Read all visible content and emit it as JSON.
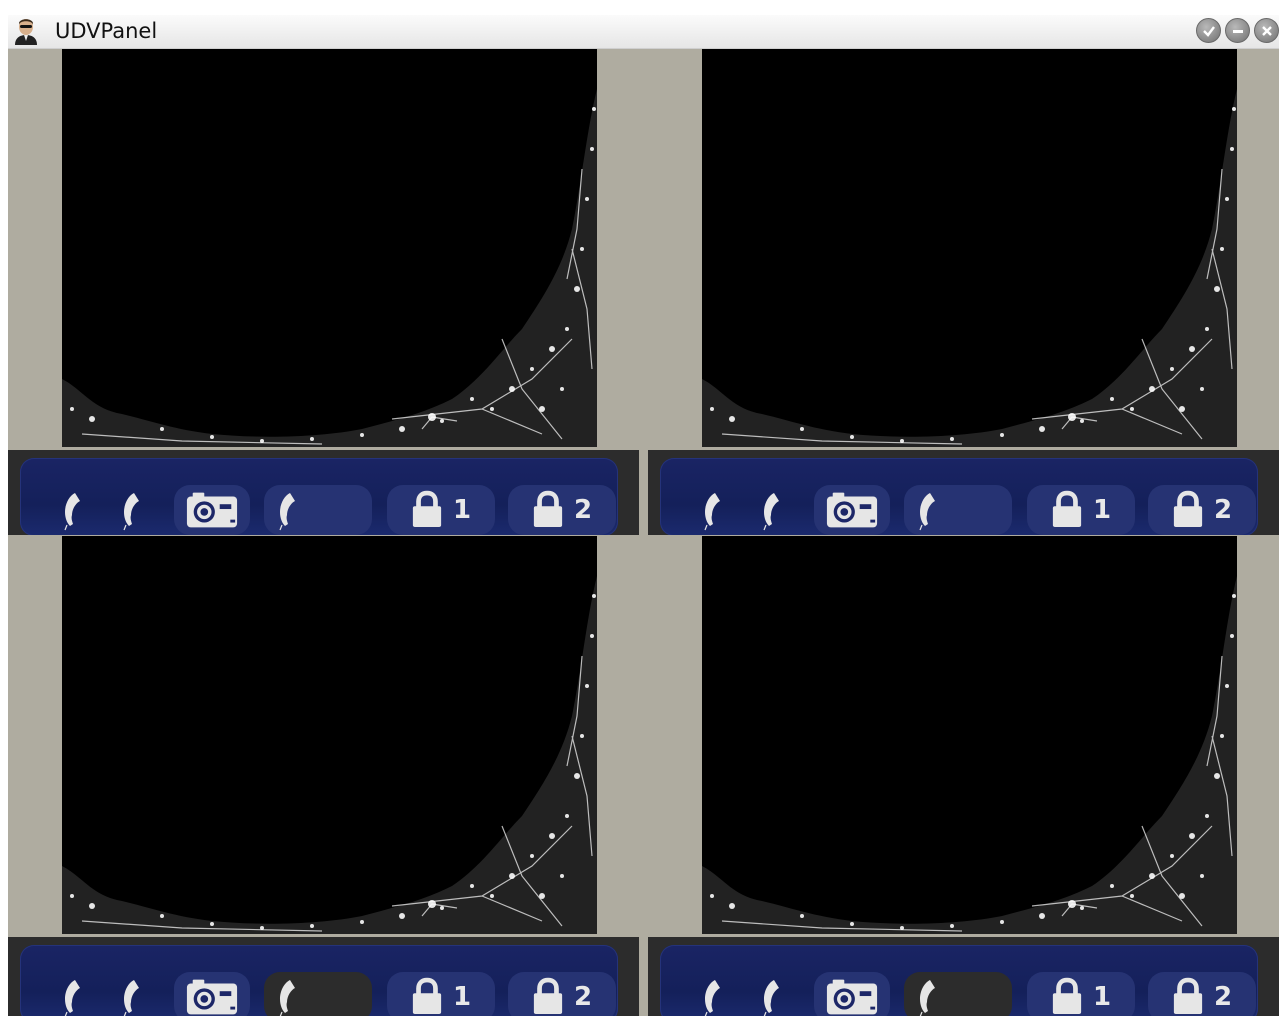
{
  "window": {
    "title": "UDVPanel",
    "app_icon": "agent-avatar-icon",
    "buttons": [
      {
        "name": "confirm-window-button",
        "icon": "check-icon"
      },
      {
        "name": "minimize-window-button",
        "icon": "minus-icon"
      },
      {
        "name": "close-window-button",
        "icon": "close-icon"
      }
    ]
  },
  "panels": [
    {
      "id": "panel-1",
      "open_door_1_label": "1",
      "open_door_2_label": "2",
      "call_active": true
    },
    {
      "id": "panel-2",
      "open_door_1_label": "1",
      "open_door_2_label": "2",
      "call_active": true
    },
    {
      "id": "panel-3",
      "open_door_1_label": "1",
      "open_door_2_label": "2",
      "call_active": false
    },
    {
      "id": "panel-4",
      "open_door_1_label": "1",
      "open_door_2_label": "2",
      "call_active": false
    }
  ],
  "colors": {
    "window_bg": "#afaca0",
    "control_panel": "#1a2464",
    "control_pill": "#263373",
    "control_pill_inactive": "#2c2c2c",
    "icon": "#e6e6e6"
  },
  "icons": {
    "answer": "phone-handset-icon",
    "hangup": "phone-handset-icon",
    "snapshot": "camera-icon",
    "call": "phone-handset-icon",
    "lock": "padlock-icon"
  }
}
